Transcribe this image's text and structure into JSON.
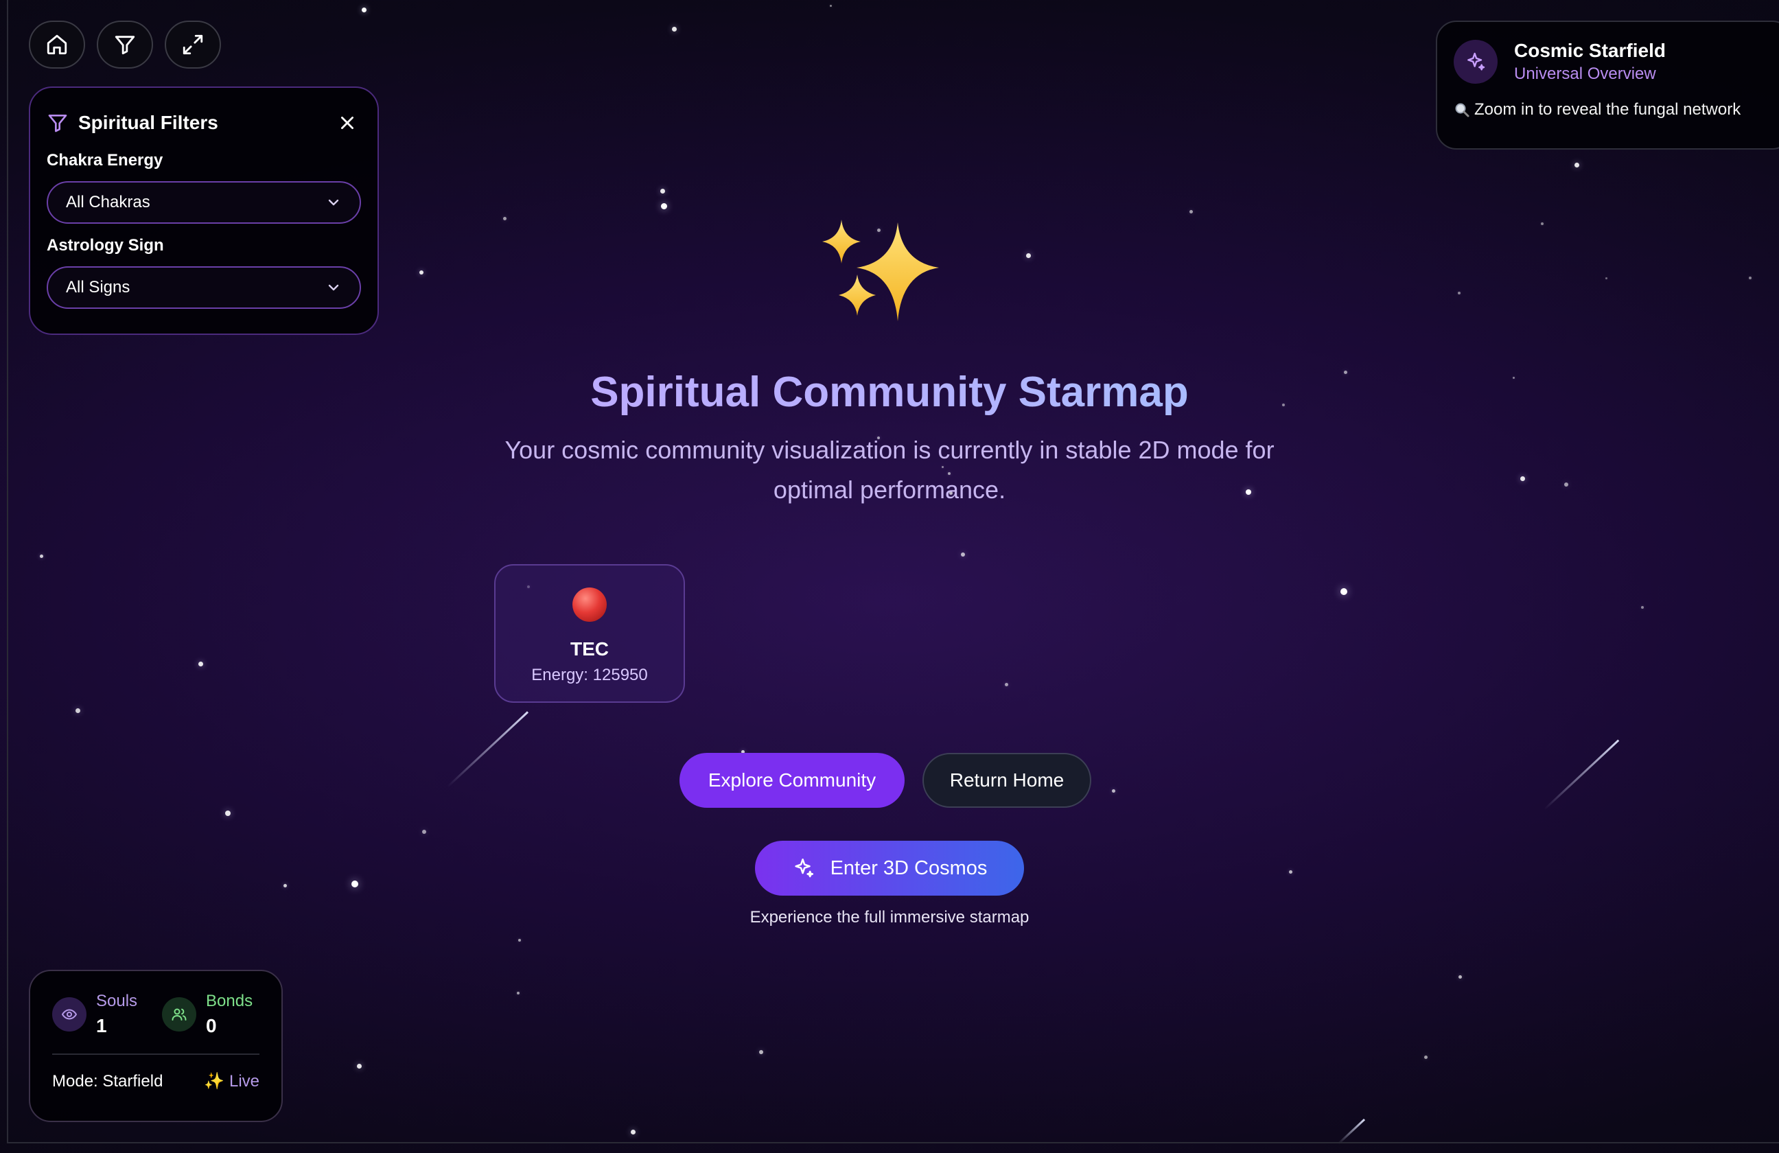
{
  "toolbar": {
    "buttons": [
      {
        "name": "home-button",
        "icon": "home-icon"
      },
      {
        "name": "filter-button",
        "icon": "filter-icon"
      },
      {
        "name": "fullscreen-button",
        "icon": "expand-icon"
      }
    ]
  },
  "filters": {
    "title": "Spiritual Filters",
    "chakra": {
      "label": "Chakra Energy",
      "value": "All Chakras"
    },
    "astrology": {
      "label": "Astrology Sign",
      "value": "All Signs"
    }
  },
  "info_panel": {
    "title": "Cosmic Starfield",
    "subtitle": "Universal Overview",
    "hint": "Zoom in to reveal the fungal network",
    "hint_icon": "magnifier-icon"
  },
  "hero": {
    "emoji": "sparkles-icon",
    "title": "Spiritual Community Starmap",
    "subtitle": "Your cosmic community visualization is currently in stable 2D mode for optimal performance."
  },
  "node": {
    "name": "TEC",
    "energy": "Energy: 125950",
    "color": "#e53935"
  },
  "actions": {
    "explore": "Explore Community",
    "return_home": "Return Home",
    "enter_3d": "Enter 3D Cosmos",
    "enter_3d_caption": "Experience the full immersive starmap"
  },
  "stats": {
    "souls_label": "Souls",
    "souls_value": "1",
    "bonds_label": "Bonds",
    "bonds_value": "0",
    "mode": "Mode: Starfield",
    "live": "✨ Live"
  },
  "colors": {
    "accent": "#7b2ff0",
    "accent_light": "#b98df0",
    "bonds_green": "#7ee08a",
    "souls_purple": "#b59ae8",
    "background": "#0c0818"
  }
}
